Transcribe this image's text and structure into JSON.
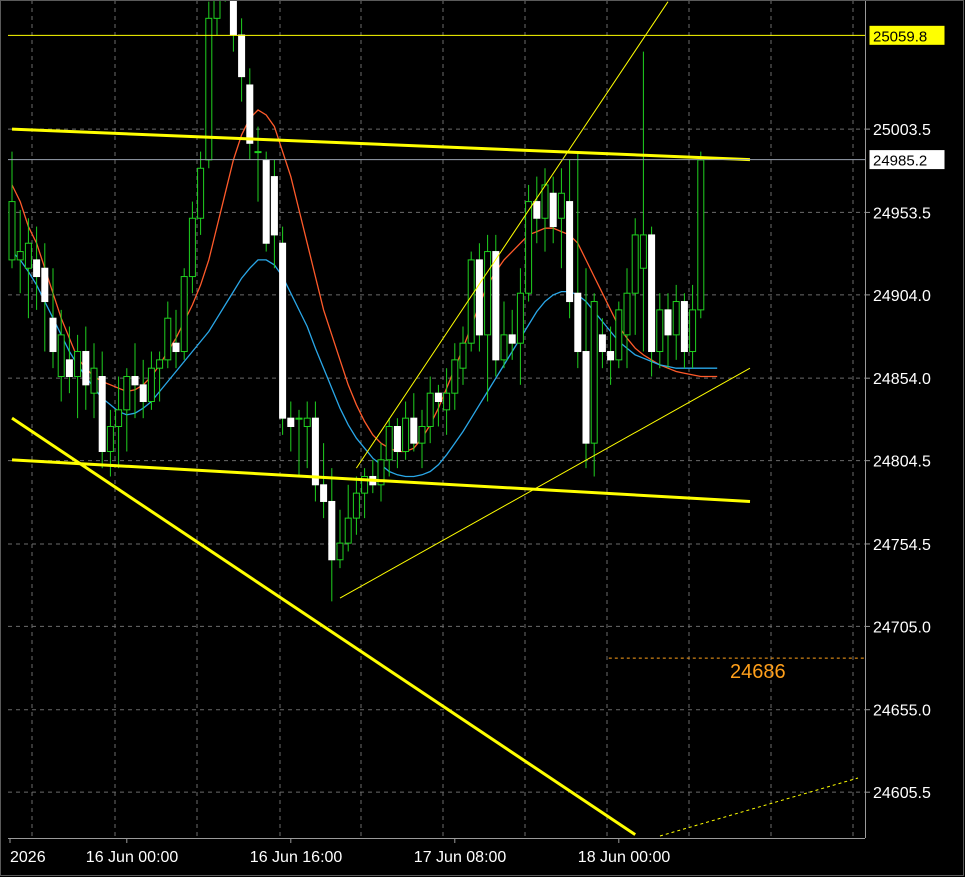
{
  "chart_data": {
    "type": "candlestick",
    "y_axis": {
      "ylim": [
        24578,
        25081
      ],
      "tick_values": [
        25003.5,
        24953.5,
        24904.0,
        24854.0,
        24804.5,
        24754.5,
        24705.0,
        24655.0,
        24605.5
      ],
      "tick_labels": [
        "25003.5",
        "24953.5",
        "24904.0",
        "24854.0",
        "24804.5",
        "24754.5",
        "24705.0",
        "24655.0",
        "24605.5"
      ]
    },
    "x_axis": {
      "tick_labels": [
        "2026",
        "16 Jun 00:00",
        "16 Jun 16:00",
        "17 Jun 08:00",
        "18 Jun 00:00"
      ],
      "tick_bar_index": [
        0,
        14,
        34,
        54,
        74
      ]
    },
    "grid": true,
    "price_tags": [
      {
        "label": "25059.8",
        "value": 25059.8,
        "style": "highlight",
        "color": "#ffff00"
      },
      {
        "label": "24985.2",
        "value": 24985.2,
        "style": "current",
        "color": "#ffffff"
      }
    ],
    "annotations": [
      {
        "label": "24686",
        "value": 24686,
        "color": "#ff9f1a"
      }
    ],
    "candles": [
      [
        24925,
        24990,
        24920,
        24960
      ],
      [
        24925,
        24955,
        24905,
        24930
      ],
      [
        24920,
        24950,
        24890,
        24935
      ],
      [
        24925,
        24945,
        24895,
        24915
      ],
      [
        24920,
        24935,
        24870,
        24900
      ],
      [
        24890,
        24920,
        24860,
        24870
      ],
      [
        24855,
        24895,
        24840,
        24880
      ],
      [
        24865,
        24885,
        24845,
        24855
      ],
      [
        24855,
        24880,
        24830,
        24870
      ],
      [
        24870,
        24885,
        24835,
        24850
      ],
      [
        24845,
        24875,
        24830,
        24860
      ],
      [
        24855,
        24870,
        24800,
        24810
      ],
      [
        24810,
        24835,
        24795,
        24825
      ],
      [
        24825,
        24855,
        24800,
        24835
      ],
      [
        24835,
        24860,
        24810,
        24855
      ],
      [
        24855,
        24875,
        24830,
        24850
      ],
      [
        24850,
        24865,
        24830,
        24840
      ],
      [
        24840,
        24870,
        24835,
        24860
      ],
      [
        24860,
        24870,
        24840,
        24865
      ],
      [
        24865,
        24900,
        24860,
        24890
      ],
      [
        24875,
        24895,
        24860,
        24870
      ],
      [
        24870,
        24920,
        24865,
        24915
      ],
      [
        24915,
        24960,
        24905,
        24950
      ],
      [
        24950,
        24990,
        24940,
        24980
      ],
      [
        24985,
        25080,
        24980,
        25070
      ],
      [
        25070,
        25120,
        25060,
        25100
      ],
      [
        25100,
        25120,
        25080,
        25110
      ],
      [
        25110,
        25120,
        25050,
        25060
      ],
      [
        25060,
        25070,
        25020,
        25035
      ],
      [
        25030,
        25040,
        24985,
        24995
      ],
      [
        24990,
        25005,
        24960,
        24990
      ],
      [
        24985,
        24990,
        24930,
        24935
      ],
      [
        24975,
        24985,
        24920,
        24940
      ],
      [
        24935,
        24945,
        24820,
        24830
      ],
      [
        24830,
        24840,
        24810,
        24825
      ],
      [
        24830,
        24835,
        24795,
        24830
      ],
      [
        24825,
        24840,
        24800,
        24830
      ],
      [
        24830,
        24840,
        24780,
        24790
      ],
      [
        24790,
        24815,
        24770,
        24780
      ],
      [
        24780,
        24800,
        24720,
        24745
      ],
      [
        24745,
        24775,
        24740,
        24755
      ],
      [
        24755,
        24790,
        24750,
        24770
      ],
      [
        24770,
        24795,
        24760,
        24785
      ],
      [
        24785,
        24800,
        24770,
        24795
      ],
      [
        24795,
        24805,
        24785,
        24790
      ],
      [
        24790,
        24815,
        24780,
        24805
      ],
      [
        24805,
        24830,
        24795,
        24825
      ],
      [
        24825,
        24830,
        24800,
        24810
      ],
      [
        24810,
        24840,
        24805,
        24830
      ],
      [
        24830,
        24845,
        24810,
        24815
      ],
      [
        24815,
        24835,
        24800,
        24825
      ],
      [
        24825,
        24855,
        24815,
        24845
      ],
      [
        24845,
        24850,
        24825,
        24840
      ],
      [
        24835,
        24860,
        24820,
        24845
      ],
      [
        24845,
        24875,
        24835,
        24865
      ],
      [
        24860,
        24885,
        24850,
        24875
      ],
      [
        24875,
        24930,
        24870,
        24925
      ],
      [
        24925,
        24935,
        24870,
        24880
      ],
      [
        24880,
        24940,
        24840,
        24930
      ],
      [
        24930,
        24940,
        24855,
        24865
      ],
      [
        24865,
        24900,
        24860,
        24880
      ],
      [
        24880,
        24895,
        24865,
        24875
      ],
      [
        24875,
        24920,
        24850,
        24905
      ],
      [
        24905,
        24970,
        24900,
        24960
      ],
      [
        24960,
        24975,
        24935,
        24950
      ],
      [
        24950,
        24980,
        24930,
        24970
      ],
      [
        24965,
        24975,
        24935,
        24945
      ],
      [
        24950,
        24980,
        24920,
        24965
      ],
      [
        24960,
        24985,
        24890,
        24900
      ],
      [
        24905,
        24990,
        24860,
        24870
      ],
      [
        24870,
        24920,
        24800,
        24815
      ],
      [
        24815,
        24905,
        24795,
        24900
      ],
      [
        24880,
        24890,
        24860,
        24870
      ],
      [
        24870,
        24885,
        24850,
        24865
      ],
      [
        24865,
        24900,
        24860,
        24895
      ],
      [
        24880,
        24920,
        24860,
        24905
      ],
      [
        24905,
        24950,
        24880,
        24940
      ],
      [
        24920,
        25050,
        24870,
        24940
      ],
      [
        24940,
        24945,
        24855,
        24870
      ],
      [
        24870,
        24905,
        24860,
        24895
      ],
      [
        24895,
        24905,
        24860,
        24880
      ],
      [
        24880,
        24910,
        24865,
        24900
      ],
      [
        24900,
        24905,
        24860,
        24870
      ],
      [
        24870,
        24910,
        24860,
        24895
      ],
      [
        24895,
        24990,
        24890,
        24985
      ]
    ],
    "overlay_series": [
      {
        "color": "#ff5a2a",
        "values": [
          24970,
          24960,
          24945,
          24935,
          24920,
          24905,
          24890,
          24878,
          24866,
          24860,
          24855,
          24852,
          24850,
          24848,
          24846,
          24847,
          24850,
          24855,
          24862,
          24870,
          24878,
          24888,
          24898,
          24910,
          24925,
          24945,
          24965,
          24985,
          25000,
          25010,
          25015,
          25012,
          25005,
          24990,
          24975,
          24955,
          24935,
          24915,
          24895,
          24880,
          24865,
          24850,
          24838,
          24828,
          24820,
          24815,
          24812,
          24810,
          24810,
          24812,
          24818,
          24826,
          24836,
          24848,
          24860,
          24872,
          24885,
          24898,
          24910,
          24918,
          24925,
          24930,
          24935,
          24940,
          24942,
          24944,
          24944,
          24942,
          24940,
          24935,
          24925,
          24915,
          24905,
          24895,
          24885,
          24878,
          24872,
          24868,
          24865,
          24862,
          24860,
          24858,
          24857,
          24856,
          24855,
          24855,
          24855
        ]
      },
      {
        "color": "#2aa7e8",
        "values": [
          24930,
          24925,
          24918,
          24910,
          24900,
          24890,
          24880,
          24870,
          24862,
          24855,
          24848,
          24842,
          24838,
          24834,
          24832,
          24833,
          24836,
          24840,
          24846,
          24852,
          24858,
          24864,
          24870,
          24876,
          24882,
          24890,
          24898,
          24906,
          24914,
          24920,
          24925,
          24925,
          24922,
          24915,
          24905,
          24895,
          24885,
          24872,
          24860,
          24848,
          24836,
          24826,
          24818,
          24812,
          24806,
          24802,
          24798,
          24796,
          24795,
          24795,
          24796,
          24798,
          24802,
          24808,
          24815,
          24822,
          24830,
          24838,
          24846,
          24854,
          24862,
          24870,
          24878,
          24886,
          24894,
          24900,
          24904,
          24906,
          24906,
          24904,
          24900,
          24894,
          24888,
          24882,
          24876,
          24872,
          24868,
          24866,
          24864,
          24862,
          24861,
          24860,
          24860,
          24860,
          24860,
          24860,
          24860
        ]
      }
    ],
    "trendlines": [
      {
        "from": [
          0,
          25003.5
        ],
        "to": [
          90,
          24985.2
        ],
        "color": "#ffff00",
        "width": 3
      },
      {
        "from": [
          0,
          24805
        ],
        "to": [
          90,
          24780
        ],
        "color": "#ffff00",
        "width": 3
      },
      {
        "from": [
          0,
          24830
        ],
        "to": [
          76,
          24580
        ],
        "color": "#ffff00",
        "width": 3
      },
      {
        "from": [
          40,
          24722
        ],
        "to": [
          90,
          24860
        ],
        "color": "#ffff00",
        "width": 1
      },
      {
        "from": [
          42,
          24800
        ],
        "to": [
          80,
          25080
        ],
        "color": "#ffff00",
        "width": 1
      }
    ],
    "hlines": [
      {
        "value": 25059.8,
        "color": "#ffff00",
        "width": 1
      },
      {
        "value": 24985.2,
        "color": "#9aa3b0",
        "width": 1
      }
    ],
    "annotation_line": {
      "value": 24686,
      "color": "#ff9f1a",
      "from_bar": 74
    }
  }
}
